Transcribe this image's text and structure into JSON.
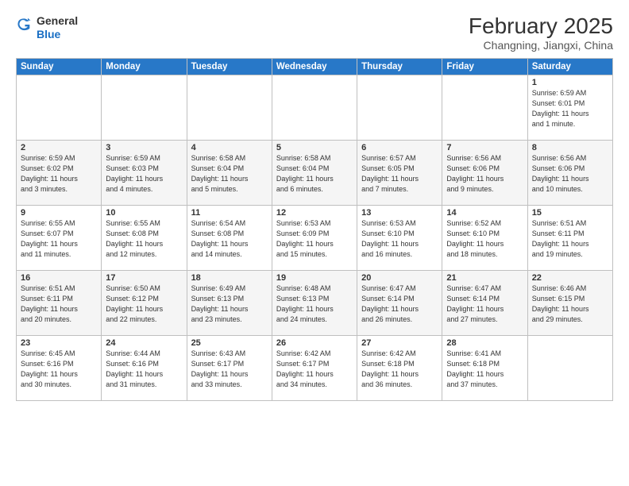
{
  "header": {
    "logo_general": "General",
    "logo_blue": "Blue",
    "month_title": "February 2025",
    "location": "Changning, Jiangxi, China"
  },
  "weekdays": [
    "Sunday",
    "Monday",
    "Tuesday",
    "Wednesday",
    "Thursday",
    "Friday",
    "Saturday"
  ],
  "weeks": [
    [
      {
        "day": "",
        "info": ""
      },
      {
        "day": "",
        "info": ""
      },
      {
        "day": "",
        "info": ""
      },
      {
        "day": "",
        "info": ""
      },
      {
        "day": "",
        "info": ""
      },
      {
        "day": "",
        "info": ""
      },
      {
        "day": "1",
        "info": "Sunrise: 6:59 AM\nSunset: 6:01 PM\nDaylight: 11 hours\nand 1 minute."
      }
    ],
    [
      {
        "day": "2",
        "info": "Sunrise: 6:59 AM\nSunset: 6:02 PM\nDaylight: 11 hours\nand 3 minutes."
      },
      {
        "day": "3",
        "info": "Sunrise: 6:59 AM\nSunset: 6:03 PM\nDaylight: 11 hours\nand 4 minutes."
      },
      {
        "day": "4",
        "info": "Sunrise: 6:58 AM\nSunset: 6:04 PM\nDaylight: 11 hours\nand 5 minutes."
      },
      {
        "day": "5",
        "info": "Sunrise: 6:58 AM\nSunset: 6:04 PM\nDaylight: 11 hours\nand 6 minutes."
      },
      {
        "day": "6",
        "info": "Sunrise: 6:57 AM\nSunset: 6:05 PM\nDaylight: 11 hours\nand 7 minutes."
      },
      {
        "day": "7",
        "info": "Sunrise: 6:56 AM\nSunset: 6:06 PM\nDaylight: 11 hours\nand 9 minutes."
      },
      {
        "day": "8",
        "info": "Sunrise: 6:56 AM\nSunset: 6:06 PM\nDaylight: 11 hours\nand 10 minutes."
      }
    ],
    [
      {
        "day": "9",
        "info": "Sunrise: 6:55 AM\nSunset: 6:07 PM\nDaylight: 11 hours\nand 11 minutes."
      },
      {
        "day": "10",
        "info": "Sunrise: 6:55 AM\nSunset: 6:08 PM\nDaylight: 11 hours\nand 12 minutes."
      },
      {
        "day": "11",
        "info": "Sunrise: 6:54 AM\nSunset: 6:08 PM\nDaylight: 11 hours\nand 14 minutes."
      },
      {
        "day": "12",
        "info": "Sunrise: 6:53 AM\nSunset: 6:09 PM\nDaylight: 11 hours\nand 15 minutes."
      },
      {
        "day": "13",
        "info": "Sunrise: 6:53 AM\nSunset: 6:10 PM\nDaylight: 11 hours\nand 16 minutes."
      },
      {
        "day": "14",
        "info": "Sunrise: 6:52 AM\nSunset: 6:10 PM\nDaylight: 11 hours\nand 18 minutes."
      },
      {
        "day": "15",
        "info": "Sunrise: 6:51 AM\nSunset: 6:11 PM\nDaylight: 11 hours\nand 19 minutes."
      }
    ],
    [
      {
        "day": "16",
        "info": "Sunrise: 6:51 AM\nSunset: 6:11 PM\nDaylight: 11 hours\nand 20 minutes."
      },
      {
        "day": "17",
        "info": "Sunrise: 6:50 AM\nSunset: 6:12 PM\nDaylight: 11 hours\nand 22 minutes."
      },
      {
        "day": "18",
        "info": "Sunrise: 6:49 AM\nSunset: 6:13 PM\nDaylight: 11 hours\nand 23 minutes."
      },
      {
        "day": "19",
        "info": "Sunrise: 6:48 AM\nSunset: 6:13 PM\nDaylight: 11 hours\nand 24 minutes."
      },
      {
        "day": "20",
        "info": "Sunrise: 6:47 AM\nSunset: 6:14 PM\nDaylight: 11 hours\nand 26 minutes."
      },
      {
        "day": "21",
        "info": "Sunrise: 6:47 AM\nSunset: 6:14 PM\nDaylight: 11 hours\nand 27 minutes."
      },
      {
        "day": "22",
        "info": "Sunrise: 6:46 AM\nSunset: 6:15 PM\nDaylight: 11 hours\nand 29 minutes."
      }
    ],
    [
      {
        "day": "23",
        "info": "Sunrise: 6:45 AM\nSunset: 6:16 PM\nDaylight: 11 hours\nand 30 minutes."
      },
      {
        "day": "24",
        "info": "Sunrise: 6:44 AM\nSunset: 6:16 PM\nDaylight: 11 hours\nand 31 minutes."
      },
      {
        "day": "25",
        "info": "Sunrise: 6:43 AM\nSunset: 6:17 PM\nDaylight: 11 hours\nand 33 minutes."
      },
      {
        "day": "26",
        "info": "Sunrise: 6:42 AM\nSunset: 6:17 PM\nDaylight: 11 hours\nand 34 minutes."
      },
      {
        "day": "27",
        "info": "Sunrise: 6:42 AM\nSunset: 6:18 PM\nDaylight: 11 hours\nand 36 minutes."
      },
      {
        "day": "28",
        "info": "Sunrise: 6:41 AM\nSunset: 6:18 PM\nDaylight: 11 hours\nand 37 minutes."
      },
      {
        "day": "",
        "info": ""
      }
    ]
  ]
}
